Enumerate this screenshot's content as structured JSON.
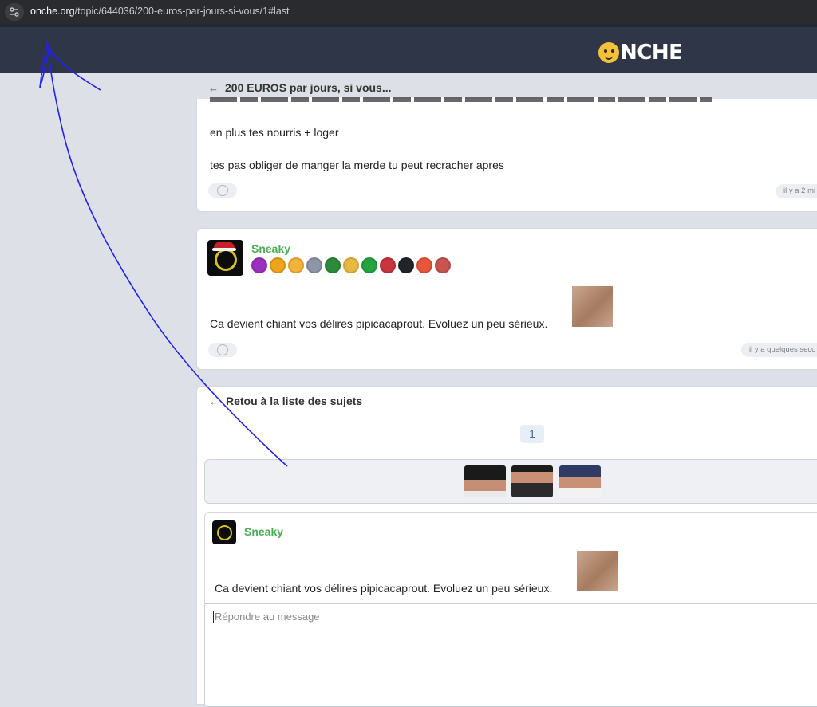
{
  "browser": {
    "url_host": "onche.org",
    "url_path": "/topic/644036/200-euros-par-jours-si-vous/1#last"
  },
  "site": {
    "logo_text": "NCHE"
  },
  "topic": {
    "title": "200 EUROS par jours, si vous..."
  },
  "posts": [
    {
      "lines": [
        "en plus tes nourris + loger",
        "tes pas obliger de manger la merde tu peut recracher apres"
      ],
      "time": "il y a 2 mi"
    },
    {
      "author": "Sneaky",
      "text": "Ca devient chiant vos délires pipicacaprout. Evoluez un peu sérieux.",
      "time": "il y a quelques seco"
    }
  ],
  "navigation": {
    "back_to_list": "Retou à la liste des sujets",
    "page": "1"
  },
  "quote": {
    "author": "Sneaky",
    "text": "Ca devient chiant vos délires pipicacaprout. Evoluez un peu sérieux."
  },
  "reply": {
    "placeholder": "Répondre au message"
  },
  "colors": {
    "header_bg": "#2e3648",
    "username": "#4bad55",
    "annotation": "#2222ee"
  }
}
